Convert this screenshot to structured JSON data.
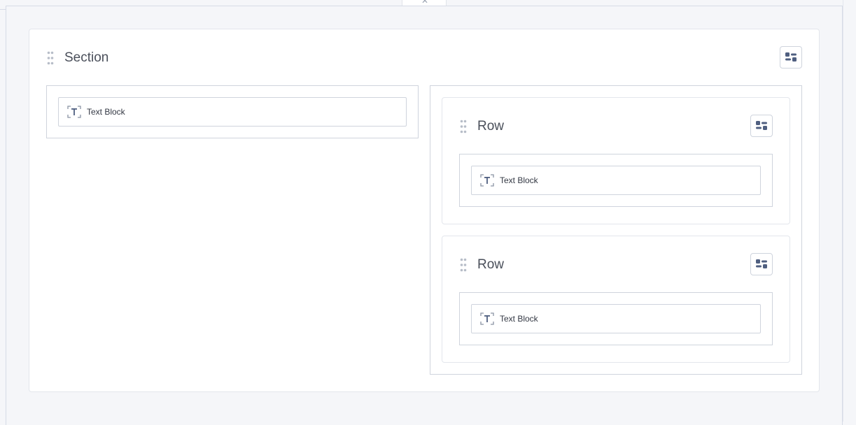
{
  "colors": {
    "accent_icon": "#4f5f80",
    "border": "#cfd4dd",
    "background": "#f5f6f9"
  },
  "topbar": {
    "close_icon": "close-icon"
  },
  "section": {
    "title": "Section",
    "settings_icon": "settings-toggle-icon",
    "left_column": {
      "blocks": [
        {
          "label": "Text Block",
          "icon": "text-block-icon"
        }
      ]
    },
    "right_column": {
      "rows": [
        {
          "title": "Row",
          "settings_icon": "settings-toggle-icon",
          "blocks": [
            {
              "label": "Text Block",
              "icon": "text-block-icon"
            }
          ]
        },
        {
          "title": "Row",
          "settings_icon": "settings-toggle-icon",
          "blocks": [
            {
              "label": "Text Block",
              "icon": "text-block-icon"
            }
          ]
        }
      ]
    }
  }
}
